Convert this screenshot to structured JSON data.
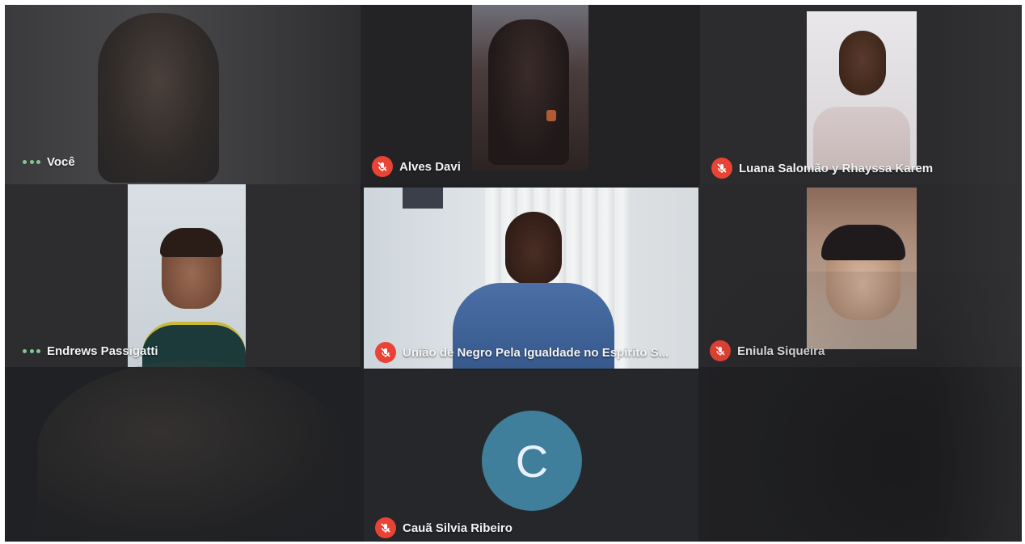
{
  "meeting": {
    "participants": [
      {
        "name": "Você",
        "status": "more-options-icon"
      },
      {
        "name": "Alves Davi",
        "status": "mic-off-icon"
      },
      {
        "name": "Luana Salomão y Rhayssa Karem",
        "status": "mic-off-icon"
      },
      {
        "name": "Endrews Passigatti",
        "status": "more-options-icon"
      },
      {
        "name": "União de Negro Pela Igualdade no Espirito S...",
        "status": "mic-off-icon"
      },
      {
        "name": "Eniula Siqueira",
        "status": "mic-off-icon"
      },
      {
        "name": "Cauã Silvia Ribeiro",
        "status": "mic-off-icon",
        "avatar_initial": "C"
      }
    ]
  },
  "colors": {
    "background": "#202124",
    "mic_off": "#ea4335",
    "active_dots": "#81c995",
    "avatar_bg": "#3f7f9b"
  }
}
